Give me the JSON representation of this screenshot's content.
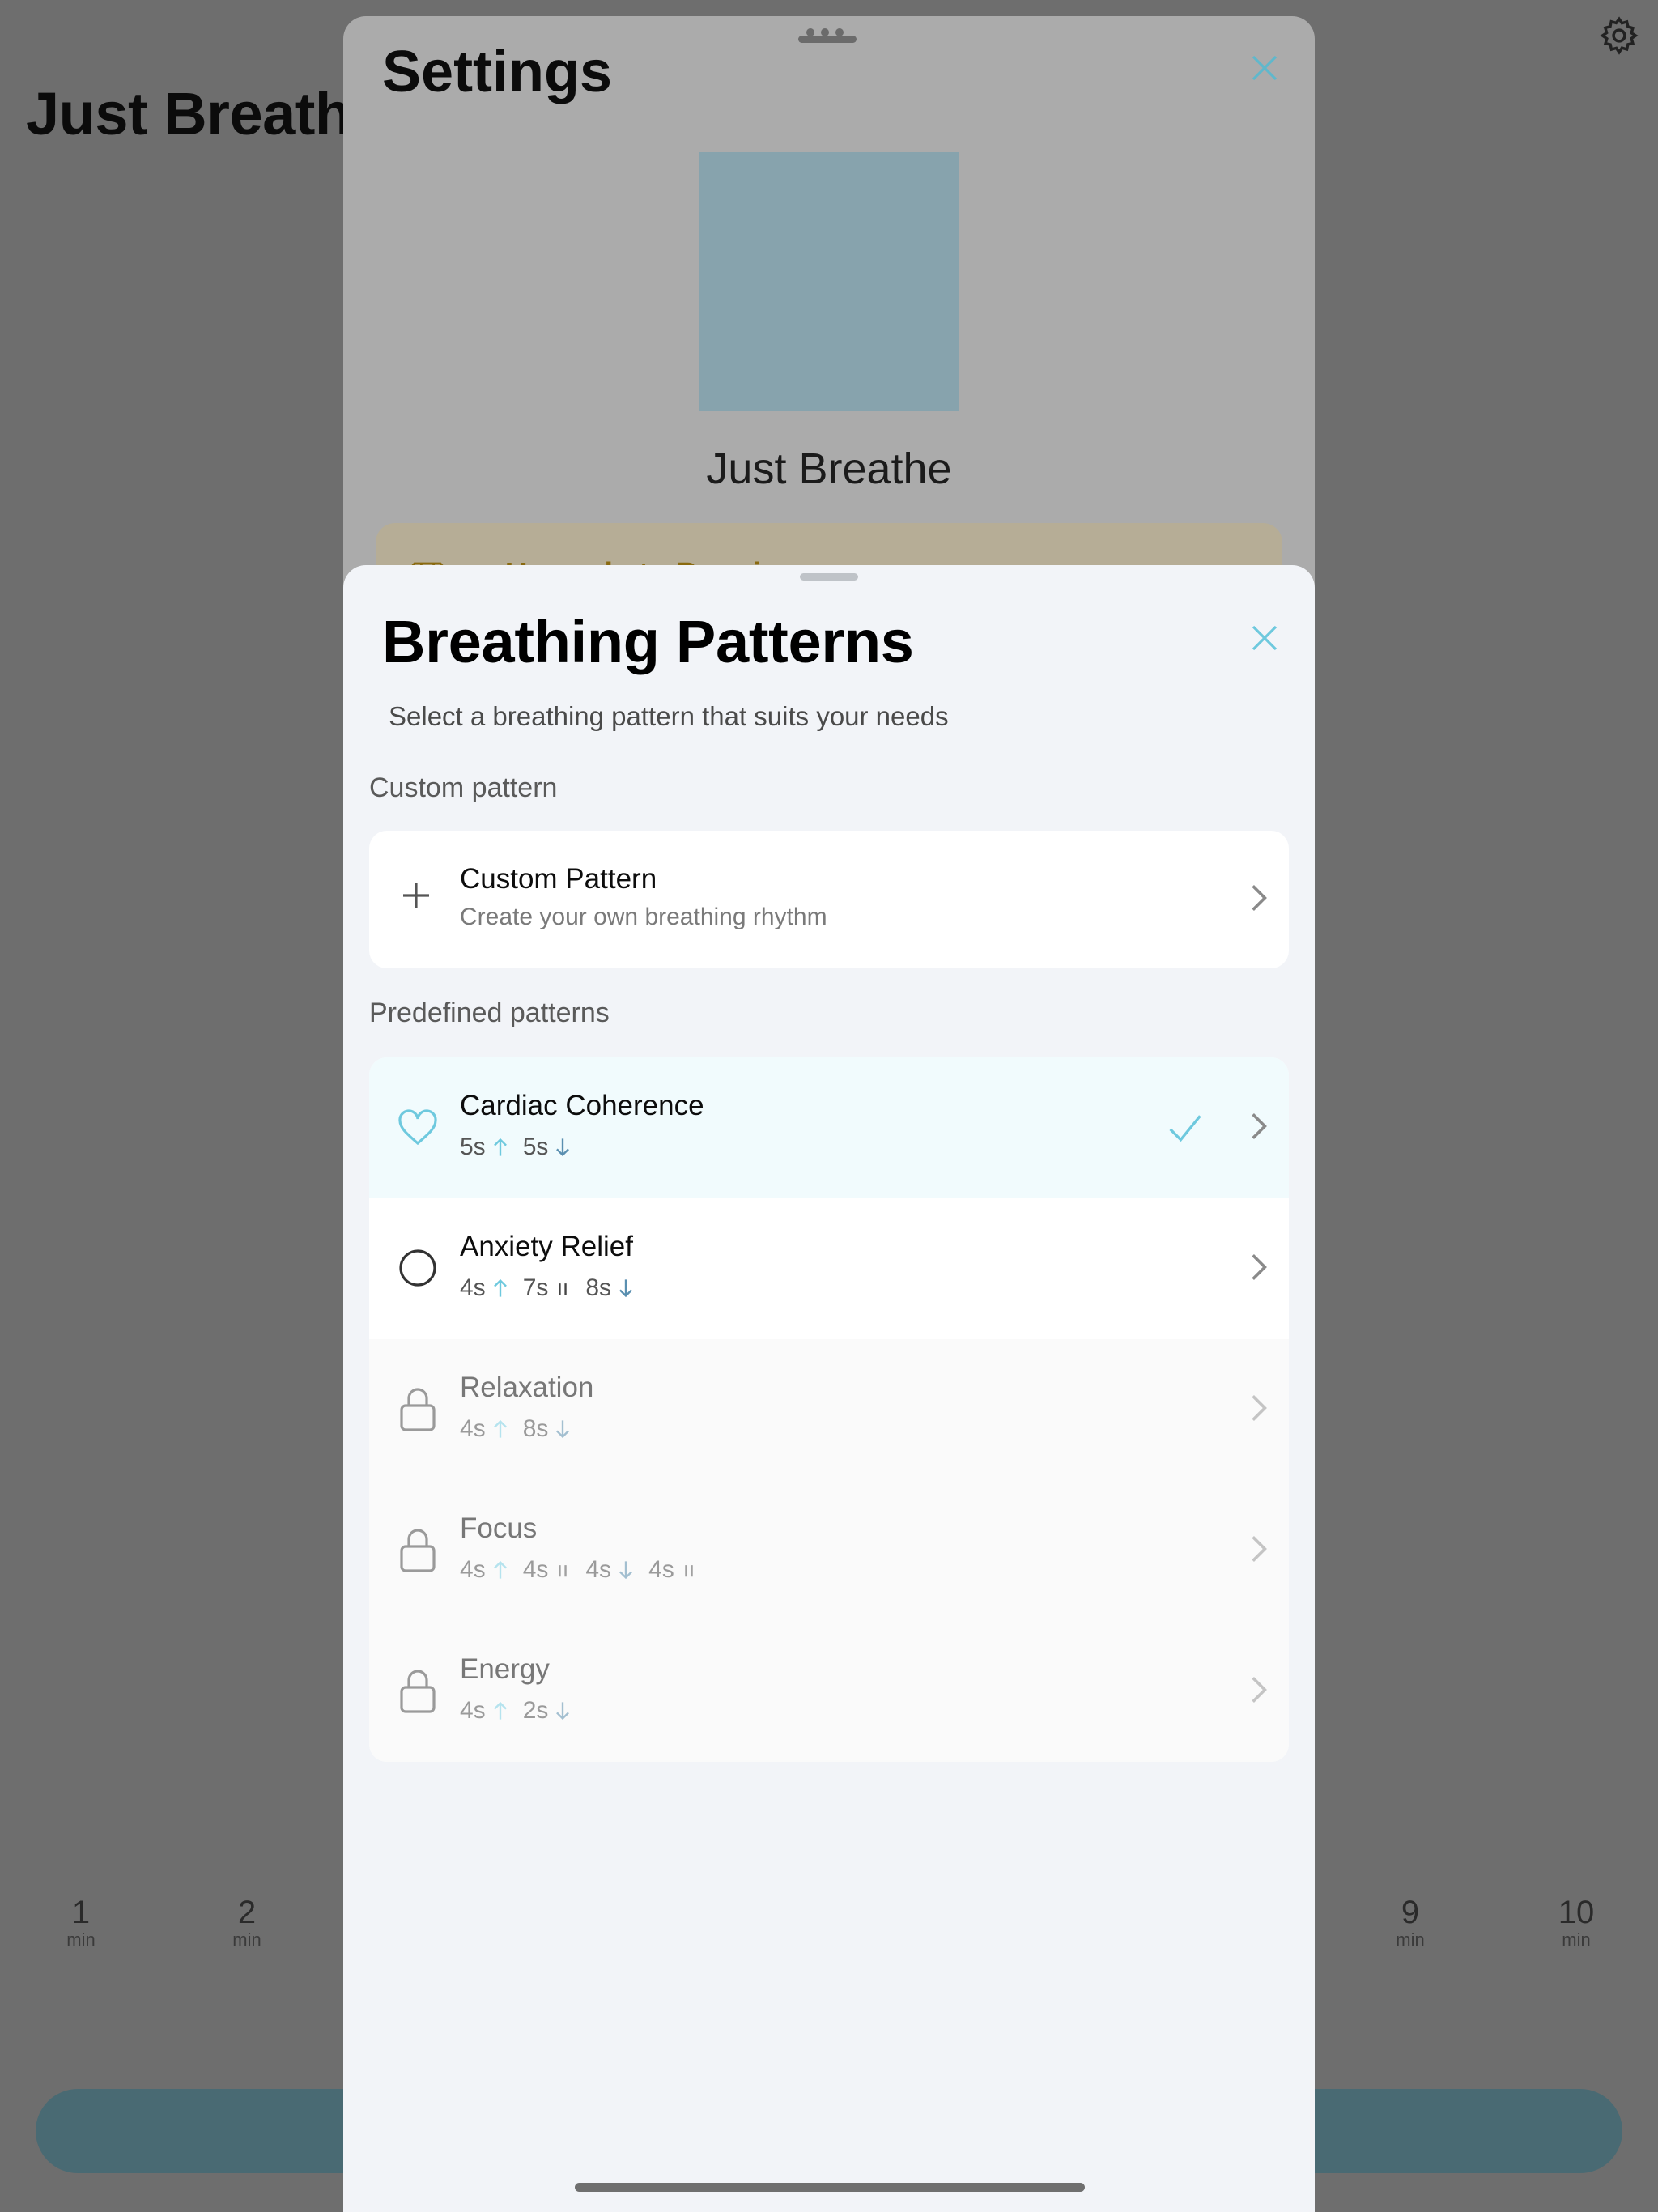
{
  "background": {
    "app_title": "Just Breathe",
    "minutes_left": [
      {
        "num": "1",
        "unit": "min"
      },
      {
        "num": "2",
        "unit": "min"
      }
    ],
    "minutes_right": [
      {
        "num": "9",
        "unit": "min"
      },
      {
        "num": "10",
        "unit": "min"
      }
    ],
    "settings_icon": "gear-icon"
  },
  "settings": {
    "title": "Settings",
    "app_name": "Just Breathe",
    "premium_label": "Upgrade to Premium",
    "close_icon": "close-icon"
  },
  "patterns": {
    "title": "Breathing Patterns",
    "subtitle": "Select a breathing pattern that suits your needs",
    "custom_section": "Custom pattern",
    "custom": {
      "title": "Custom Pattern",
      "subtitle": "Create your own breathing rhythm",
      "icon": "plus-icon"
    },
    "predefined_section": "Predefined patterns",
    "items": [
      {
        "title": "Cardiac Coherence",
        "icon": "heart-icon",
        "state": "selected",
        "steps": [
          {
            "t": "5s",
            "k": "inhale"
          },
          {
            "t": "5s",
            "k": "exhale"
          }
        ]
      },
      {
        "title": "Anxiety Relief",
        "icon": "circle-icon",
        "state": "available",
        "steps": [
          {
            "t": "4s",
            "k": "inhale"
          },
          {
            "t": "7s",
            "k": "hold"
          },
          {
            "t": "8s",
            "k": "exhale"
          }
        ]
      },
      {
        "title": "Relaxation",
        "icon": "lock-icon",
        "state": "locked",
        "steps": [
          {
            "t": "4s",
            "k": "inhale"
          },
          {
            "t": "8s",
            "k": "exhale"
          }
        ]
      },
      {
        "title": "Focus",
        "icon": "lock-icon",
        "state": "locked",
        "steps": [
          {
            "t": "4s",
            "k": "inhale"
          },
          {
            "t": "4s",
            "k": "hold"
          },
          {
            "t": "4s",
            "k": "exhale"
          },
          {
            "t": "4s",
            "k": "hold"
          }
        ]
      },
      {
        "title": "Energy",
        "icon": "lock-icon",
        "state": "locked",
        "steps": [
          {
            "t": "4s",
            "k": "inhale"
          },
          {
            "t": "2s",
            "k": "exhale"
          }
        ]
      }
    ]
  },
  "colors": {
    "accent": "#6ec9de",
    "exhale": "#5a8fb0",
    "premium": "#c79a1c"
  }
}
